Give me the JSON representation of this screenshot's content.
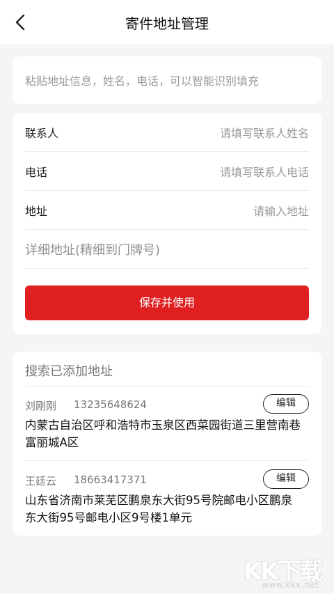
{
  "header": {
    "title": "寄件地址管理"
  },
  "paste": {
    "placeholder": "粘贴地址信息，姓名，电话，可以智能识别填充"
  },
  "form": {
    "contact_label": "联系人",
    "contact_placeholder": "请填写联系人姓名",
    "phone_label": "电话",
    "phone_placeholder": "请填写联系人电话",
    "address_label": "地址",
    "address_placeholder": "请输入地址",
    "detail_placeholder": "详细地址(精细到门牌号)",
    "save_label": "保存并使用"
  },
  "saved": {
    "title": "搜索已添加地址",
    "edit_label": "编辑",
    "items": [
      {
        "name": "刘刚刚",
        "phone": "13235648624",
        "address": "内蒙古自治区呼和浩特市玉泉区西菜园街道三里营南巷富丽城A区"
      },
      {
        "name": "王廷云",
        "phone": "18663417371",
        "address": "山东省济南市莱芜区鹏泉东大街95号院邮电小区鹏泉东大街95号邮电小区9号楼1单元"
      }
    ]
  },
  "watermark": {
    "logo": "KK下载",
    "url": "www.kkx.net"
  },
  "icons": {
    "back": "chevron-left-icon"
  },
  "colors": {
    "accent": "#e02020",
    "background": "#f5f5f5"
  }
}
